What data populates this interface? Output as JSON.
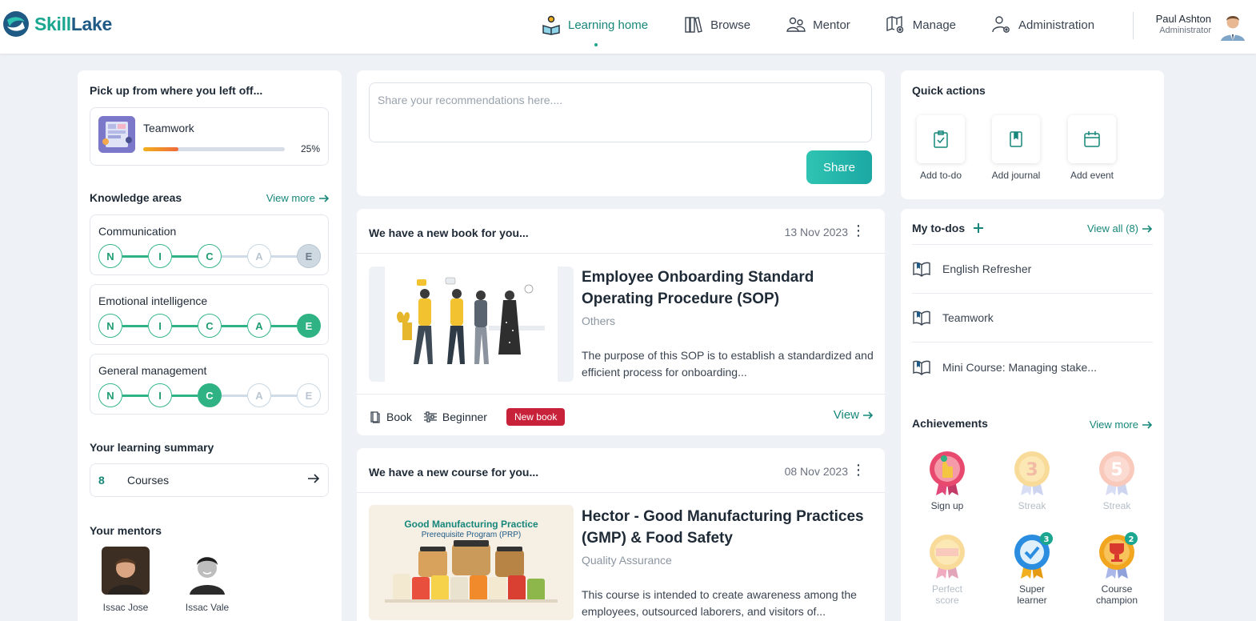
{
  "brand": {
    "name_part1": "Skill",
    "name_part2": "Lake"
  },
  "nav": {
    "items": [
      {
        "label": "Learning home",
        "icon": "reader-icon",
        "active": true
      },
      {
        "label": "Browse",
        "icon": "books-icon"
      },
      {
        "label": "Mentor",
        "icon": "mentor-icon"
      },
      {
        "label": "Manage",
        "icon": "manage-icon"
      },
      {
        "label": "Administration",
        "icon": "admin-user-icon"
      }
    ]
  },
  "user": {
    "name": "Paul Ashton",
    "role": "Administrator"
  },
  "left": {
    "resume_title": "Pick up from where you left off...",
    "resume_item": {
      "title": "Teamwork",
      "progress_label": "25%",
      "progress": 0.25
    },
    "knowledge": {
      "title": "Knowledge areas",
      "view_more": "View more",
      "areas": [
        {
          "name": "Communication",
          "levels": [
            "N",
            "I",
            "C",
            "A",
            "E"
          ],
          "reached": 3,
          "grey_last": true
        },
        {
          "name": "Emotional intelligence",
          "levels": [
            "N",
            "I",
            "C",
            "A",
            "E"
          ],
          "reached": 5
        },
        {
          "name": "General management",
          "levels": [
            "N",
            "I",
            "C",
            "A",
            "E"
          ],
          "reached": 3
        }
      ]
    },
    "summary": {
      "title": "Your learning summary",
      "count": "8",
      "label": "Courses"
    },
    "mentors": {
      "title": "Your mentors",
      "people": [
        {
          "name": "Issac Jose"
        },
        {
          "name": "Issac Vale"
        }
      ]
    }
  },
  "share": {
    "placeholder": "Share your recommendations here....",
    "button": "Share"
  },
  "feed": [
    {
      "heading": "We have a new book for you...",
      "date": "13 Nov 2023",
      "title": "Employee Onboarding Standard Operating Procedure (SOP)",
      "category": "Others",
      "description": "The purpose of this SOP is to establish a standardized and efficient process for onboarding...",
      "type": "Book",
      "level": "Beginner",
      "badge": "New book",
      "view": "View"
    },
    {
      "heading": "We have a new course for you...",
      "date": "08 Nov 2023",
      "title": "Hector - Good Manufacturing Practices (GMP) & Food Safety",
      "category": "Quality Assurance",
      "description": "This course is intended to create awareness among the employees, outsourced laborers, and visitors of...",
      "image_title": "Good Manufacturing Practice",
      "image_subtitle": "Prerequisite Program (PRP)"
    }
  ],
  "quick_actions": {
    "title": "Quick actions",
    "items": [
      {
        "label": "Add to-do",
        "icon": "checklist-icon"
      },
      {
        "label": "Add journal",
        "icon": "journal-icon"
      },
      {
        "label": "Add event",
        "icon": "calendar-icon"
      }
    ]
  },
  "todos": {
    "title": "My to-dos",
    "view_all": "View all (8)",
    "items": [
      {
        "label": "English Refresher"
      },
      {
        "label": "Teamwork"
      },
      {
        "label": "Mini Course: Managing stake..."
      }
    ]
  },
  "achievements": {
    "title": "Achievements",
    "view_more": "View more",
    "items": [
      {
        "label": "Sign up",
        "earned": true
      },
      {
        "label": "Streak",
        "earned": false,
        "value": "3"
      },
      {
        "label": "Streak",
        "earned": false,
        "value": "5"
      },
      {
        "label": "Perfect score",
        "earned": false
      },
      {
        "label": "Super learner",
        "earned": true,
        "count": "3"
      },
      {
        "label": "Course champion",
        "earned": true,
        "count": "2"
      }
    ]
  },
  "colors": {
    "accent": "#1aa68f",
    "brand_blue": "#1f5a85",
    "badge_red": "#c8213a",
    "page_bg": "#eef1f6"
  }
}
